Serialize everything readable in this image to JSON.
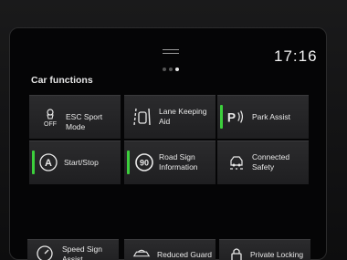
{
  "status": {
    "time": "17:16"
  },
  "page": {
    "title": "Car functions",
    "dots": 3,
    "active_dot": 2
  },
  "tiles": [
    {
      "label": "ESC Sport Mode",
      "icon": "esc-off-icon",
      "on": false
    },
    {
      "label": "Lane Keeping Aid",
      "icon": "lane-keeping-icon",
      "on": false
    },
    {
      "label": "Park Assist",
      "icon": "park-assist-icon",
      "on": true
    },
    {
      "label": "Start/Stop",
      "icon": "start-stop-icon",
      "on": true
    },
    {
      "label": "Road Sign Information",
      "icon": "road-sign-icon",
      "on": true
    },
    {
      "label": "Connected Safety",
      "icon": "connected-safety-icon",
      "on": false
    },
    {
      "label": "Speed Sign Assist",
      "icon": "speed-sign-icon",
      "on": false
    },
    {
      "label": "Reduced Guard",
      "icon": "reduced-guard-icon",
      "on": false
    },
    {
      "label": "Private Locking",
      "icon": "private-locking-icon",
      "on": false
    }
  ],
  "colors": {
    "active": "#3ccf3c"
  }
}
